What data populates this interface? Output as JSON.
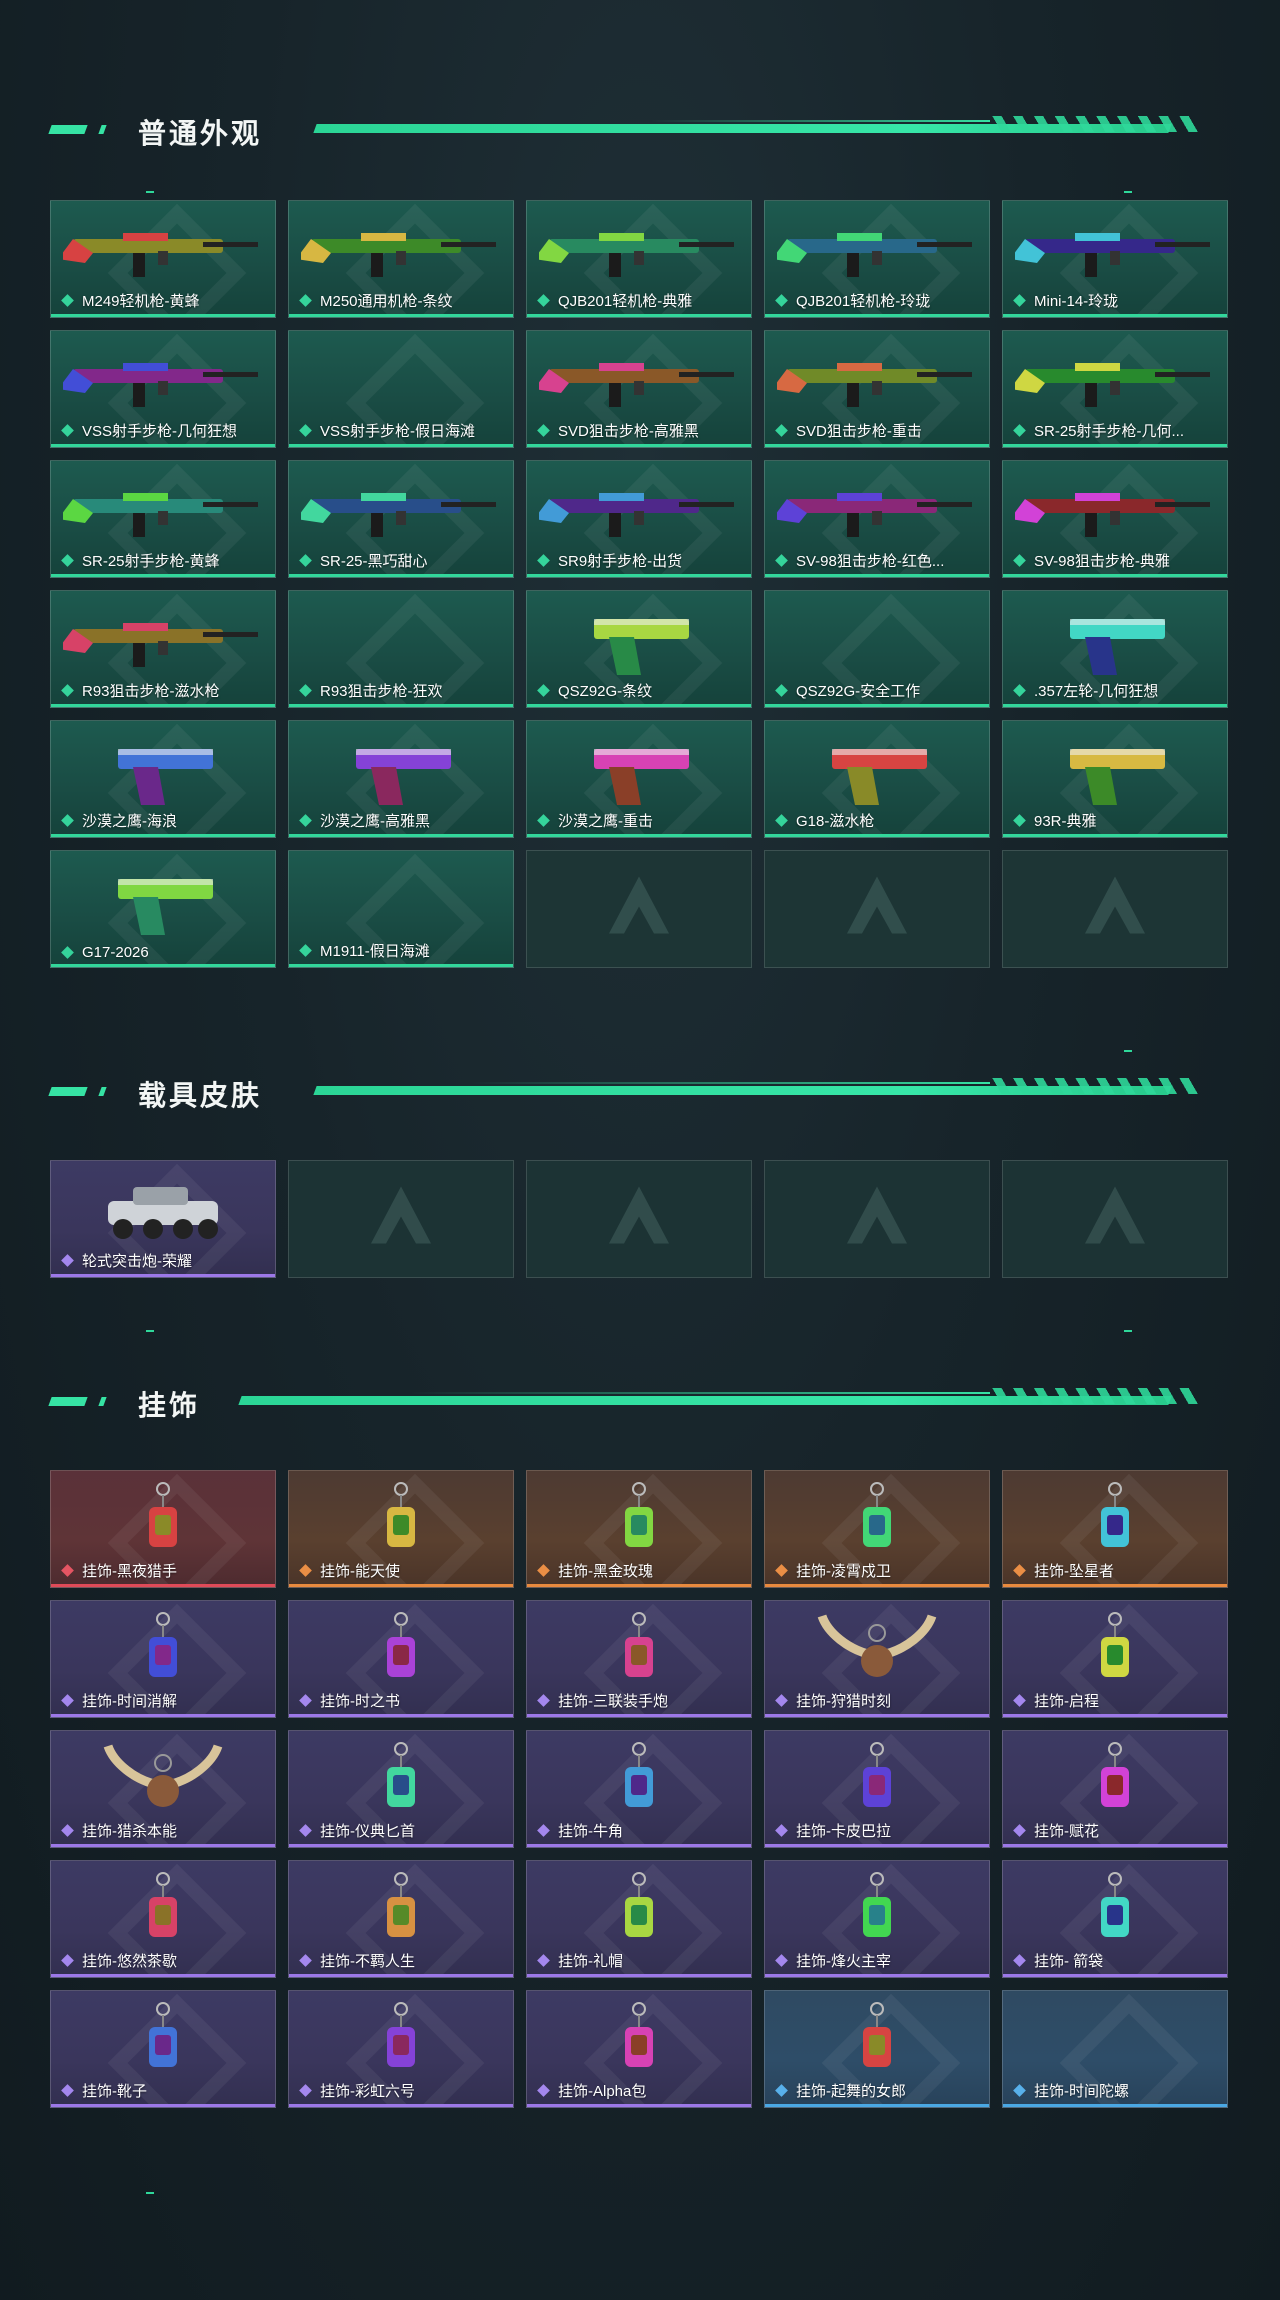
{
  "colors": {
    "accent": "#36e3a4",
    "rarity_green": "#32d79b",
    "rarity_purple": "#9c78e8",
    "rarity_orange": "#e98a3e",
    "rarity_red": "#e04a58",
    "rarity_blue": "#4aa8e4"
  },
  "sections": {
    "weapons": {
      "title": "普通外观",
      "items": [
        {
          "label": "M249轻机枪-黄蜂",
          "rarity": "green",
          "icon": "machine-gun-icon"
        },
        {
          "label": "M250通用机枪-条纹",
          "rarity": "green",
          "icon": "machine-gun-icon"
        },
        {
          "label": "QJB201轻机枪-典雅",
          "rarity": "green",
          "icon": "machine-gun-icon"
        },
        {
          "label": "QJB201轻机枪-玲珑",
          "rarity": "green",
          "icon": "machine-gun-icon"
        },
        {
          "label": "Mini-14-玲珑",
          "rarity": "green",
          "icon": "rifle-icon"
        },
        {
          "label": "VSS射手步枪-几何狂想",
          "rarity": "green",
          "icon": "rifle-icon"
        },
        {
          "label": "VSS射手步枪-假日海滩",
          "rarity": "green",
          "icon": ""
        },
        {
          "label": "SVD狙击步枪-高雅黑",
          "rarity": "green",
          "icon": "sniper-rifle-icon"
        },
        {
          "label": "SVD狙击步枪-重击",
          "rarity": "green",
          "icon": "sniper-rifle-icon"
        },
        {
          "label": "SR-25射手步枪-几何...",
          "rarity": "green",
          "icon": "rifle-icon"
        },
        {
          "label": "SR-25射手步枪-黄蜂",
          "rarity": "green",
          "icon": "rifle-icon"
        },
        {
          "label": "SR-25-黑巧甜心",
          "rarity": "green",
          "icon": "rifle-icon"
        },
        {
          "label": "SR9射手步枪-出货",
          "rarity": "green",
          "icon": "rifle-icon"
        },
        {
          "label": "SV-98狙击步枪-红色...",
          "rarity": "green",
          "icon": "sniper-rifle-icon"
        },
        {
          "label": "SV-98狙击步枪-典雅",
          "rarity": "green",
          "icon": "sniper-rifle-icon"
        },
        {
          "label": "R93狙击步枪-滋水枪",
          "rarity": "green",
          "icon": "sniper-rifle-icon"
        },
        {
          "label": "R93狙击步枪-狂欢",
          "rarity": "green",
          "icon": ""
        },
        {
          "label": "QSZ92G-条纹",
          "rarity": "green",
          "icon": "pistol-icon"
        },
        {
          "label": "QSZ92G-安全工作",
          "rarity": "green",
          "icon": ""
        },
        {
          "label": ".357左轮-几何狂想",
          "rarity": "green",
          "icon": "revolver-icon"
        },
        {
          "label": "沙漠之鹰-海浪",
          "rarity": "green",
          "icon": "pistol-icon"
        },
        {
          "label": "沙漠之鹰-高雅黑",
          "rarity": "green",
          "icon": "pistol-icon"
        },
        {
          "label": "沙漠之鹰-重击",
          "rarity": "green",
          "icon": "pistol-icon"
        },
        {
          "label": "G18-滋水枪",
          "rarity": "green",
          "icon": "pistol-icon"
        },
        {
          "label": "93R-典雅",
          "rarity": "green",
          "icon": "pistol-icon"
        },
        {
          "label": "G17-2026",
          "rarity": "green",
          "icon": "pistol-icon"
        },
        {
          "label": "M1911-假日海滩",
          "rarity": "green",
          "icon": ""
        },
        {
          "label": "",
          "rarity": "empty",
          "icon": "placeholder-logo-icon"
        },
        {
          "label": "",
          "rarity": "empty",
          "icon": "placeholder-logo-icon"
        },
        {
          "label": "",
          "rarity": "empty",
          "icon": "placeholder-logo-icon"
        }
      ]
    },
    "vehicles": {
      "title": "载具皮肤",
      "items": [
        {
          "label": "轮式突击炮-荣耀",
          "rarity": "purple",
          "icon": "vehicle-icon"
        },
        {
          "label": "",
          "rarity": "empty2",
          "icon": "placeholder-logo-icon"
        },
        {
          "label": "",
          "rarity": "empty2",
          "icon": "placeholder-logo-icon"
        },
        {
          "label": "",
          "rarity": "empty2",
          "icon": "placeholder-logo-icon"
        },
        {
          "label": "",
          "rarity": "empty2",
          "icon": "placeholder-logo-icon"
        }
      ]
    },
    "charms": {
      "title": "挂饰",
      "items": [
        {
          "label": "挂饰-黑夜猎手",
          "rarity": "red",
          "icon": "charm-icon"
        },
        {
          "label": "挂饰-能天使",
          "rarity": "orange",
          "icon": "charm-icon"
        },
        {
          "label": "挂饰-黑金玫瑰",
          "rarity": "orange",
          "icon": "charm-icon"
        },
        {
          "label": "挂饰-凌霄戍卫",
          "rarity": "orange",
          "icon": "charm-icon"
        },
        {
          "label": "挂饰-坠星者",
          "rarity": "orange",
          "icon": "charm-icon"
        },
        {
          "label": "挂饰-时间消解",
          "rarity": "purple",
          "icon": "charm-icon"
        },
        {
          "label": "挂饰-时之书",
          "rarity": "purple",
          "icon": "charm-icon"
        },
        {
          "label": "挂饰-三联装手炮",
          "rarity": "purple",
          "icon": "charm-icon"
        },
        {
          "label": "挂饰-狩猎时刻",
          "rarity": "purple",
          "icon": "antler-charm-icon"
        },
        {
          "label": "挂饰-启程",
          "rarity": "purple",
          "icon": "charm-icon"
        },
        {
          "label": "挂饰-猎杀本能",
          "rarity": "purple",
          "icon": "antler-charm-icon"
        },
        {
          "label": "挂饰-仪典匕首",
          "rarity": "purple",
          "icon": "dagger-charm-icon"
        },
        {
          "label": "挂饰-牛角",
          "rarity": "purple",
          "icon": "horn-charm-icon"
        },
        {
          "label": "挂饰-卡皮巴拉",
          "rarity": "purple",
          "icon": "charm-icon"
        },
        {
          "label": "挂饰-赋花",
          "rarity": "purple",
          "icon": "rose-charm-icon"
        },
        {
          "label": "挂饰-悠然茶歇",
          "rarity": "purple",
          "icon": "cupcake-charm-icon"
        },
        {
          "label": "挂饰-不羁人生",
          "rarity": "purple",
          "icon": "sneaker-charm-icon"
        },
        {
          "label": "挂饰-礼帽",
          "rarity": "purple",
          "icon": "hat-charm-icon"
        },
        {
          "label": "挂饰-烽火主宰",
          "rarity": "purple",
          "icon": "banner-charm-icon"
        },
        {
          "label": "挂饰- 箭袋",
          "rarity": "purple",
          "icon": "quiver-charm-icon"
        },
        {
          "label": "挂饰-靴子",
          "rarity": "purple",
          "icon": "boot-charm-icon"
        },
        {
          "label": "挂饰-彩虹六号",
          "rarity": "purple",
          "icon": "charm-icon"
        },
        {
          "label": "挂饰-Alpha包",
          "rarity": "purple",
          "icon": "bag-charm-icon"
        },
        {
          "label": "挂饰-起舞的女郎",
          "rarity": "blue",
          "icon": "charm-icon"
        },
        {
          "label": "挂饰-时间陀螺",
          "rarity": "blue",
          "icon": ""
        }
      ]
    }
  }
}
